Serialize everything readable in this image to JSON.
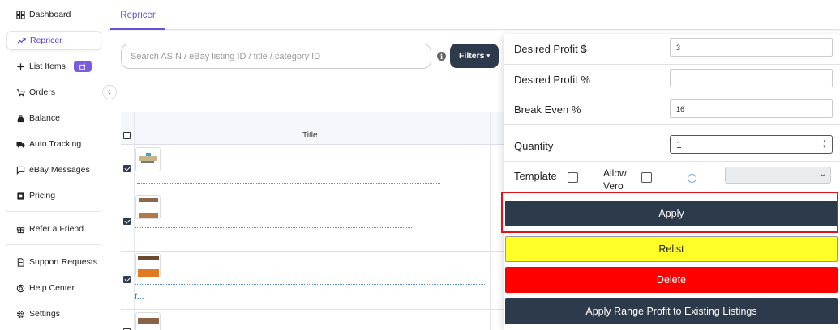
{
  "sidebar": {
    "items": [
      {
        "label": "Dashboard",
        "icon": "dashboard-icon"
      },
      {
        "label": "Repricer",
        "icon": "trending-icon",
        "active": true
      },
      {
        "label": "List Items",
        "icon": "plus-icon"
      },
      {
        "label": "Orders",
        "icon": "cart-icon"
      },
      {
        "label": "Balance",
        "icon": "moneybag-icon"
      },
      {
        "label": "Auto Tracking",
        "icon": "truck-icon"
      },
      {
        "label": "eBay Messages",
        "icon": "message-icon"
      },
      {
        "label": "Pricing",
        "icon": "pricing-icon"
      },
      {
        "label": "Refer a Friend",
        "icon": "gift-icon"
      },
      {
        "label": "Support Requests",
        "icon": "document-icon"
      },
      {
        "label": "Help Center",
        "icon": "lifebuoy-icon"
      },
      {
        "label": "Settings",
        "icon": "gear-icon"
      }
    ],
    "collapse_glyph": "‹"
  },
  "tabs": [
    {
      "label": "Repricer",
      "active": true
    }
  ],
  "search": {
    "placeholder": "Search ASIN / eBay listing ID / title / category ID"
  },
  "info_glyph": "i",
  "filters": {
    "label": "Filters",
    "caret": "▾"
  },
  "table": {
    "headers": {
      "title": "Title"
    },
    "rows": [
      {
        "checked": true,
        "more": ""
      },
      {
        "checked": true,
        "more": ""
      },
      {
        "checked": true,
        "more": "f..."
      },
      {
        "checked": true,
        "more": ""
      }
    ]
  },
  "panel": {
    "fields": {
      "desired_profit_usd": {
        "label": "Desired Profit $",
        "value": "3"
      },
      "desired_profit_pct": {
        "label": "Desired Profit %",
        "value": ""
      },
      "break_even_pct": {
        "label": "Break Even %",
        "value": "16"
      },
      "quantity": {
        "label": "Quantity",
        "value": "1"
      }
    },
    "template_label": "Template",
    "allow_vero_label": "Allow Vero",
    "info_glyph": "i",
    "chevron": "⌄",
    "spin_up": "▲",
    "spin_down": "▼",
    "buttons": {
      "apply": "Apply",
      "relist": "Relist",
      "delete": "Delete",
      "apply_range": "Apply Range Profit to Existing Listings"
    }
  },
  "colors": {
    "accent": "#6a4fd8",
    "navy_button": "#2c3a4c",
    "relist_yellow": "#ffff27",
    "delete_red": "#ff0000",
    "highlight_outline": "#e3111a"
  }
}
